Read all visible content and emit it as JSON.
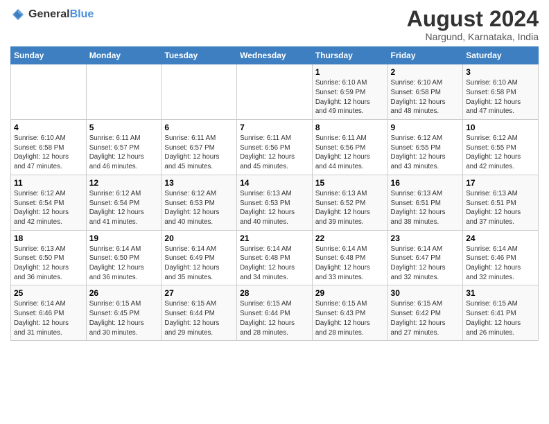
{
  "logo": {
    "general": "General",
    "blue": "Blue"
  },
  "title": "August 2024",
  "subtitle": "Nargund, Karnataka, India",
  "headers": [
    "Sunday",
    "Monday",
    "Tuesday",
    "Wednesday",
    "Thursday",
    "Friday",
    "Saturday"
  ],
  "weeks": [
    [
      {
        "day": "",
        "info": ""
      },
      {
        "day": "",
        "info": ""
      },
      {
        "day": "",
        "info": ""
      },
      {
        "day": "",
        "info": ""
      },
      {
        "day": "1",
        "info": "Sunrise: 6:10 AM\nSunset: 6:59 PM\nDaylight: 12 hours\nand 49 minutes."
      },
      {
        "day": "2",
        "info": "Sunrise: 6:10 AM\nSunset: 6:58 PM\nDaylight: 12 hours\nand 48 minutes."
      },
      {
        "day": "3",
        "info": "Sunrise: 6:10 AM\nSunset: 6:58 PM\nDaylight: 12 hours\nand 47 minutes."
      }
    ],
    [
      {
        "day": "4",
        "info": "Sunrise: 6:10 AM\nSunset: 6:58 PM\nDaylight: 12 hours\nand 47 minutes."
      },
      {
        "day": "5",
        "info": "Sunrise: 6:11 AM\nSunset: 6:57 PM\nDaylight: 12 hours\nand 46 minutes."
      },
      {
        "day": "6",
        "info": "Sunrise: 6:11 AM\nSunset: 6:57 PM\nDaylight: 12 hours\nand 45 minutes."
      },
      {
        "day": "7",
        "info": "Sunrise: 6:11 AM\nSunset: 6:56 PM\nDaylight: 12 hours\nand 45 minutes."
      },
      {
        "day": "8",
        "info": "Sunrise: 6:11 AM\nSunset: 6:56 PM\nDaylight: 12 hours\nand 44 minutes."
      },
      {
        "day": "9",
        "info": "Sunrise: 6:12 AM\nSunset: 6:55 PM\nDaylight: 12 hours\nand 43 minutes."
      },
      {
        "day": "10",
        "info": "Sunrise: 6:12 AM\nSunset: 6:55 PM\nDaylight: 12 hours\nand 42 minutes."
      }
    ],
    [
      {
        "day": "11",
        "info": "Sunrise: 6:12 AM\nSunset: 6:54 PM\nDaylight: 12 hours\nand 42 minutes."
      },
      {
        "day": "12",
        "info": "Sunrise: 6:12 AM\nSunset: 6:54 PM\nDaylight: 12 hours\nand 41 minutes."
      },
      {
        "day": "13",
        "info": "Sunrise: 6:12 AM\nSunset: 6:53 PM\nDaylight: 12 hours\nand 40 minutes."
      },
      {
        "day": "14",
        "info": "Sunrise: 6:13 AM\nSunset: 6:53 PM\nDaylight: 12 hours\nand 40 minutes."
      },
      {
        "day": "15",
        "info": "Sunrise: 6:13 AM\nSunset: 6:52 PM\nDaylight: 12 hours\nand 39 minutes."
      },
      {
        "day": "16",
        "info": "Sunrise: 6:13 AM\nSunset: 6:51 PM\nDaylight: 12 hours\nand 38 minutes."
      },
      {
        "day": "17",
        "info": "Sunrise: 6:13 AM\nSunset: 6:51 PM\nDaylight: 12 hours\nand 37 minutes."
      }
    ],
    [
      {
        "day": "18",
        "info": "Sunrise: 6:13 AM\nSunset: 6:50 PM\nDaylight: 12 hours\nand 36 minutes."
      },
      {
        "day": "19",
        "info": "Sunrise: 6:14 AM\nSunset: 6:50 PM\nDaylight: 12 hours\nand 36 minutes."
      },
      {
        "day": "20",
        "info": "Sunrise: 6:14 AM\nSunset: 6:49 PM\nDaylight: 12 hours\nand 35 minutes."
      },
      {
        "day": "21",
        "info": "Sunrise: 6:14 AM\nSunset: 6:48 PM\nDaylight: 12 hours\nand 34 minutes."
      },
      {
        "day": "22",
        "info": "Sunrise: 6:14 AM\nSunset: 6:48 PM\nDaylight: 12 hours\nand 33 minutes."
      },
      {
        "day": "23",
        "info": "Sunrise: 6:14 AM\nSunset: 6:47 PM\nDaylight: 12 hours\nand 32 minutes."
      },
      {
        "day": "24",
        "info": "Sunrise: 6:14 AM\nSunset: 6:46 PM\nDaylight: 12 hours\nand 32 minutes."
      }
    ],
    [
      {
        "day": "25",
        "info": "Sunrise: 6:14 AM\nSunset: 6:46 PM\nDaylight: 12 hours\nand 31 minutes."
      },
      {
        "day": "26",
        "info": "Sunrise: 6:15 AM\nSunset: 6:45 PM\nDaylight: 12 hours\nand 30 minutes."
      },
      {
        "day": "27",
        "info": "Sunrise: 6:15 AM\nSunset: 6:44 PM\nDaylight: 12 hours\nand 29 minutes."
      },
      {
        "day": "28",
        "info": "Sunrise: 6:15 AM\nSunset: 6:44 PM\nDaylight: 12 hours\nand 28 minutes."
      },
      {
        "day": "29",
        "info": "Sunrise: 6:15 AM\nSunset: 6:43 PM\nDaylight: 12 hours\nand 28 minutes."
      },
      {
        "day": "30",
        "info": "Sunrise: 6:15 AM\nSunset: 6:42 PM\nDaylight: 12 hours\nand 27 minutes."
      },
      {
        "day": "31",
        "info": "Sunrise: 6:15 AM\nSunset: 6:41 PM\nDaylight: 12 hours\nand 26 minutes."
      }
    ]
  ]
}
